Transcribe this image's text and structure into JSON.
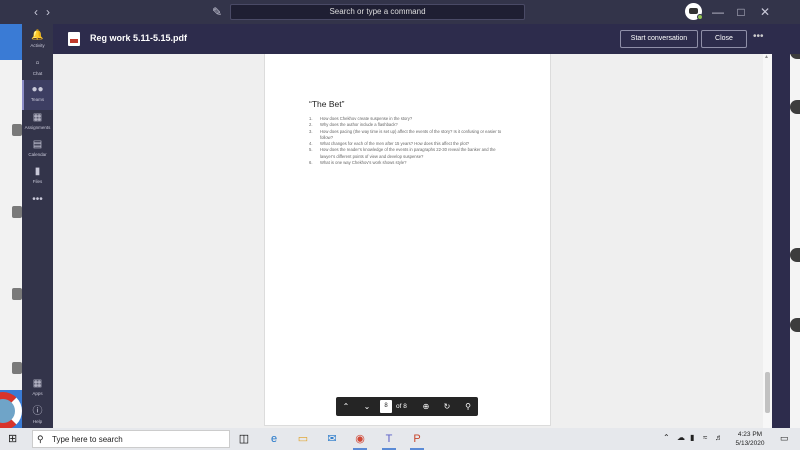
{
  "browser": {
    "search_placeholder": "Search or type a command"
  },
  "rail": {
    "items": [
      {
        "label": "Activity",
        "icon": "bell-icon"
      },
      {
        "label": "Chat",
        "icon": "chat-icon"
      },
      {
        "label": "Teams",
        "icon": "teams-icon",
        "active": true
      },
      {
        "label": "Assignments",
        "icon": "assignments-icon"
      },
      {
        "label": "Calendar",
        "icon": "calendar-icon"
      },
      {
        "label": "Files",
        "icon": "files-icon"
      },
      {
        "label": "Apps",
        "icon": "apps-icon"
      },
      {
        "label": "Help",
        "icon": "help-icon"
      }
    ]
  },
  "header": {
    "doc_title": "Reg work 5.11-5.15.pdf",
    "start_conversation": "Start conversation",
    "close": "Close"
  },
  "document": {
    "heading": "“The Bet”",
    "questions": [
      {
        "num": "1.",
        "text": "How does Chekhov create suspense in the story?"
      },
      {
        "num": "2.",
        "text": "Why does the author include a flashback?"
      },
      {
        "num": "3.",
        "text": "How does pacing (the way time is set up) affect the events of the story? Is it confusing or easier to follow?"
      },
      {
        "num": "4.",
        "text": "What changes for each of the men after 15 years? How does this affect the plot?"
      },
      {
        "num": "5.",
        "text": "How does the reader’s knowledge of the events in paragraphs 22-30 reveal the banker and the lawyer’s different points of view and develop suspense?"
      },
      {
        "num": "6.",
        "text": "What is one way Chekhov’s work shows style?"
      }
    ]
  },
  "pdf_toolbar": {
    "current_page": "8",
    "of_pages": "of 8"
  },
  "taskbar": {
    "search_placeholder": "Type here to search",
    "time": "4:23 PM",
    "date": "5/13/2020"
  },
  "colors": {
    "teams_purple": "#33344a",
    "header": "#2d2c4c",
    "accent": "#8b8cc7"
  }
}
